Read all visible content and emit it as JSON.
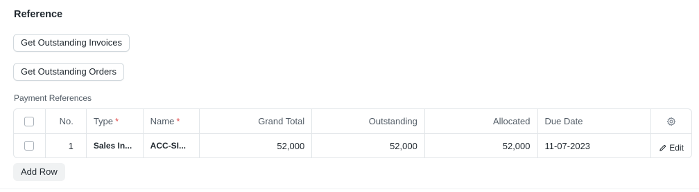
{
  "section": {
    "title": "Reference"
  },
  "buttons": {
    "get_invoices": "Get Outstanding Invoices",
    "get_orders": "Get Outstanding Orders",
    "add_row": "Add Row"
  },
  "table": {
    "label": "Payment References",
    "headers": {
      "no": "No.",
      "type": "Type",
      "name": "Name",
      "grand_total": "Grand Total",
      "outstanding": "Outstanding",
      "allocated": "Allocated",
      "due_date": "Due Date"
    },
    "required_mark": "*",
    "rows": [
      {
        "no": "1",
        "type": "Sales In...",
        "name": "ACC-SI...",
        "grand_total": "52,000",
        "outstanding": "52,000",
        "allocated": "52,000",
        "due_date": "11-07-2023",
        "edit": "Edit"
      }
    ]
  },
  "colors": {
    "required": "#e24c4c",
    "border": "#e2e6e9",
    "muted_text": "#525c66"
  },
  "icons": {
    "settings": "gear-icon",
    "edit": "pencil-icon",
    "select": "checkbox"
  }
}
